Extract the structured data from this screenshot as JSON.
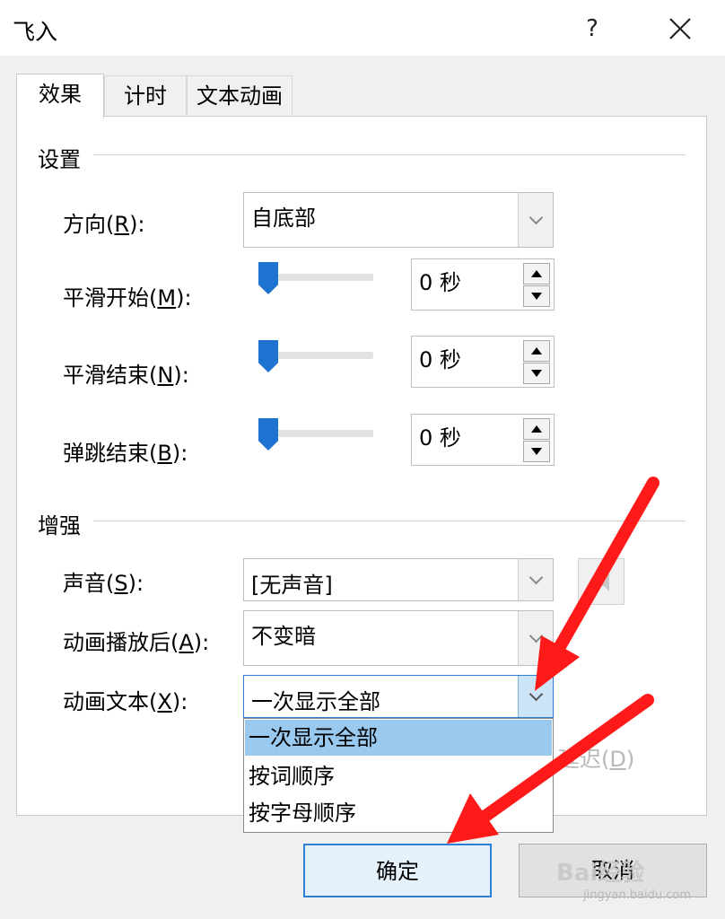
{
  "window": {
    "title": "飞入",
    "help_label": "?",
    "close_icon": "close-icon"
  },
  "tabs": [
    {
      "label": "效果",
      "selected": true
    },
    {
      "label": "计时",
      "selected": false
    },
    {
      "label": "文本动画",
      "selected": false
    }
  ],
  "settings": {
    "group_title": "设置",
    "direction": {
      "label_pre": "方向(",
      "key": "R",
      "label_post": "):",
      "value": "自底部"
    },
    "smooth_start": {
      "label_pre": "平滑开始(",
      "key": "M",
      "label_post": "):",
      "value": "0 秒",
      "level": 0
    },
    "smooth_end": {
      "label_pre": "平滑结束(",
      "key": "N",
      "label_post": "):",
      "value": "0 秒",
      "level": 0
    },
    "bounce_end": {
      "label_pre": "弹跳结束(",
      "key": "B",
      "label_post": "):",
      "value": "0 秒",
      "level": 0
    }
  },
  "enhance": {
    "group_title": "增强",
    "sound": {
      "label_pre": "声音(",
      "key": "S",
      "label_post": "):",
      "value": "[无声音]",
      "speaker_icon": "speaker-icon"
    },
    "after_anim": {
      "label_pre": "动画播放后(",
      "key": "A",
      "label_post": "):",
      "value": "不变暗"
    },
    "anim_text": {
      "label_pre": "动画文本(",
      "key": "X",
      "label_post": "):",
      "value": "一次显示全部"
    },
    "delay_partial": {
      "pre": "延迟(",
      "key": "D",
      "post": ")"
    }
  },
  "dropdown": {
    "options": [
      "一次显示全部",
      "按词顺序",
      "按字母顺序"
    ],
    "selected_index": 0,
    "highlight_color": "#99c9ef"
  },
  "footer": {
    "ok_label": "确定",
    "cancel_label": "取消"
  },
  "watermark": {
    "text": "Bai经验",
    "url": "jingyan.baidu.com"
  },
  "colors": {
    "accent": "#1e73d1",
    "arrow": "#ff1a1a"
  }
}
